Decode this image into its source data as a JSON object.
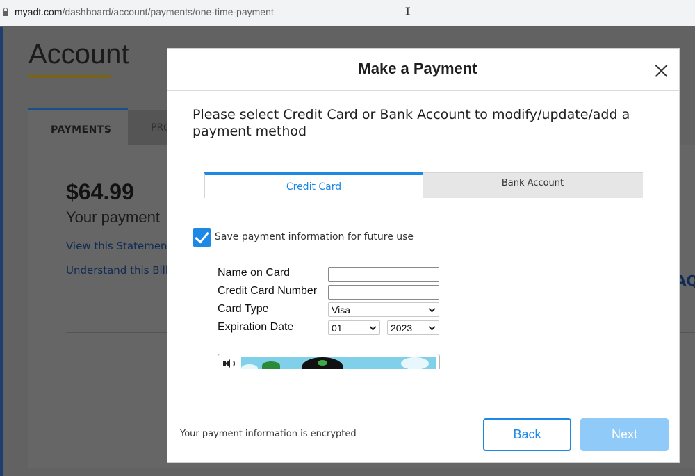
{
  "browser": {
    "url_host": "myadt.com",
    "url_path": "/dashboard/account/payments/one-time-payment"
  },
  "background": {
    "title": "Account",
    "tabs": {
      "payments": "PAYMENTS",
      "profile_partial": "PRO"
    },
    "amount": "$64.99",
    "payment_text": "Your payment",
    "link_statement": "View this Statement",
    "link_bill": "Understand this Bill",
    "faqs_partial": "AQs"
  },
  "modal": {
    "title": "Make a Payment",
    "instruction": "Please select Credit Card or Bank Account to modify/update/add a payment method",
    "tabs": {
      "credit_card": "Credit Card",
      "bank_account": "Bank Account"
    },
    "save_checkbox": {
      "label": "Save payment information for future use",
      "checked": true
    },
    "form": {
      "name_label": "Name on Card",
      "name_value": "",
      "ccnum_label": "Credit Card Number",
      "ccnum_value": "",
      "type_label": "Card Type",
      "type_value": "Visa",
      "exp_label": "Expiration Date",
      "exp_month": "01",
      "exp_year": "2023"
    },
    "footer": {
      "encrypted_note": "Your payment information is encrypted",
      "back_label": "Back",
      "next_label": "Next"
    }
  },
  "colors": {
    "accent": "#1e88e5",
    "next_disabled": "#90caf9",
    "overlay": "#626262"
  }
}
